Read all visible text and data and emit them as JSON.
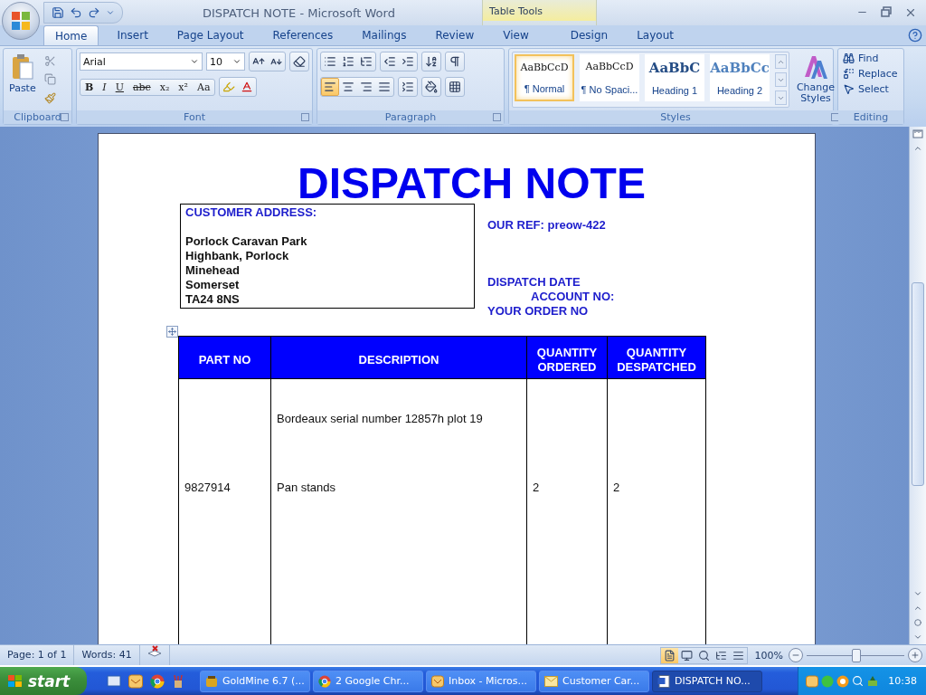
{
  "window": {
    "title": "DISPATCH NOTE - Microsoft Word"
  },
  "tabs": [
    {
      "label": "Home",
      "selected": true
    },
    {
      "label": "Insert",
      "selected": false
    },
    {
      "label": "Page Layout",
      "selected": false
    },
    {
      "label": "References",
      "selected": false
    },
    {
      "label": "Mailings",
      "selected": false
    },
    {
      "label": "Review",
      "selected": false
    },
    {
      "label": "View",
      "selected": false
    }
  ],
  "table_tools": {
    "label": "Table Tools",
    "tabs": [
      {
        "label": "Design",
        "selected": false
      },
      {
        "label": "Layout",
        "selected": false
      }
    ]
  },
  "ribbon": {
    "clipboard": {
      "label": "Clipboard",
      "paste": "Paste"
    },
    "font": {
      "label": "Font",
      "name": "Arial",
      "size": "10",
      "format_buttons": [
        {
          "label": "B",
          "kind": "bold"
        },
        {
          "label": "I",
          "kind": "italic"
        },
        {
          "label": "U",
          "kind": "underline"
        },
        {
          "label": "abc",
          "kind": "strike"
        },
        {
          "label": "x₂",
          "kind": "plain"
        },
        {
          "label": "x²",
          "kind": "plain"
        },
        {
          "label": "Aa",
          "kind": "plain"
        }
      ]
    },
    "paragraph": {
      "label": "Paragraph"
    },
    "styles": {
      "label": "Styles",
      "change": "Change Styles",
      "items": [
        {
          "preview": "AaBbCcD",
          "name": "¶ Normal",
          "kind": "body",
          "selected": true
        },
        {
          "preview": "AaBbCcD",
          "name": "¶ No Spaci...",
          "kind": "body",
          "selected": false
        },
        {
          "preview": "AaBbC",
          "name": "Heading 1",
          "kind": "heading1",
          "selected": false
        },
        {
          "preview": "AaBbCc",
          "name": "Heading 2",
          "kind": "heading2",
          "selected": false
        }
      ]
    },
    "editing": {
      "label": "Editing",
      "items": [
        {
          "label": "Find",
          "kind": "find"
        },
        {
          "label": "Replace",
          "kind": "replace"
        },
        {
          "label": "Select",
          "kind": "select"
        }
      ]
    }
  },
  "document": {
    "title": "DISPATCH NOTE",
    "address": {
      "heading": "CUSTOMER ADDRESS:",
      "lines": [
        "Porlock Caravan  Park",
        "Highbank, Porlock",
        "Minehead",
        "Somerset",
        "TA24 8NS"
      ]
    },
    "our_ref": "OUR REF: preow-422",
    "dispatch_date": "DISPATCH DATE",
    "account_no": "ACCOUNT  NO:",
    "your_order_no": "YOUR ORDER  NO",
    "table": {
      "columns": [
        "PART NO",
        "DESCRIPTION",
        "QUANTITY ORDERED",
        "QUANTITY DESPATCHED"
      ],
      "rows": [
        {
          "description": "Bordeaux serial number  12857h  plot 19"
        },
        {
          "part_no": "9827914",
          "description": "Pan stands",
          "quantity_ordered": "2",
          "quantity_despatched": "2"
        }
      ]
    }
  },
  "status_bar": {
    "page": "Page: 1 of 1",
    "words": "Words: 41",
    "zoom": "100%",
    "zoom_slider": {
      "level": 0.5
    },
    "views": [
      {
        "selected": true
      },
      {
        "selected": false
      },
      {
        "selected": false
      },
      {
        "selected": false
      },
      {
        "selected": false
      }
    ]
  },
  "taskbar": {
    "start": "start",
    "tasks": [
      {
        "label": "GoldMine 6.7 (...",
        "kind": "goldmine",
        "selected": false
      },
      {
        "label": "2 Google Chr...",
        "kind": "chrome",
        "selected": false
      },
      {
        "label": "Inbox - Micros...",
        "kind": "outlook",
        "selected": false
      },
      {
        "label": "Customer Car...",
        "kind": "mail",
        "selected": false
      },
      {
        "label": "DISPATCH NO...",
        "kind": "word",
        "selected": true
      }
    ],
    "clock": "10:38"
  }
}
